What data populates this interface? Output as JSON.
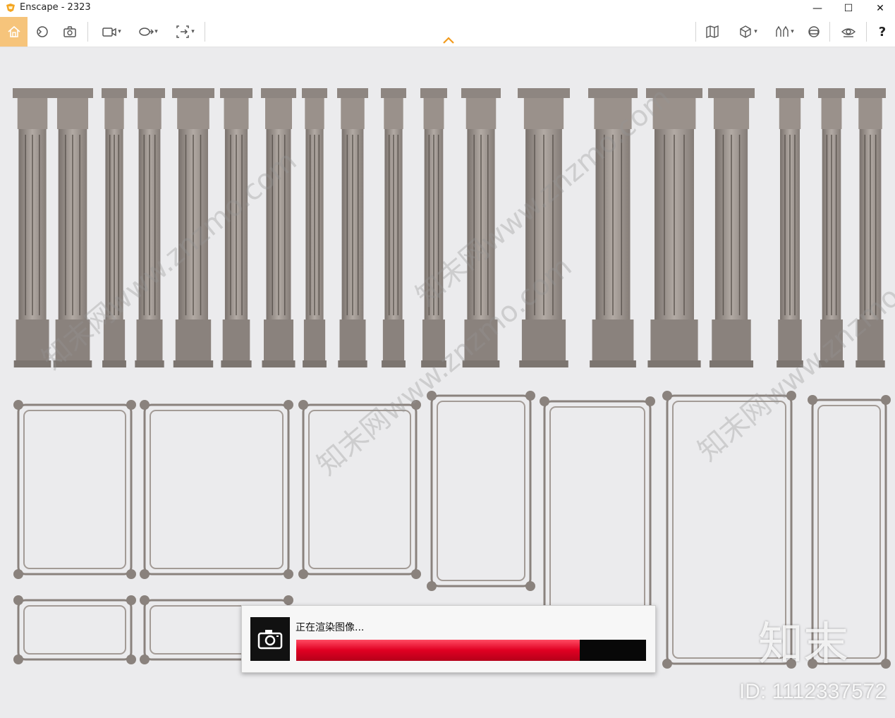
{
  "window": {
    "title": "Enscape - 2323"
  },
  "window_controls": {
    "minimize": "—",
    "maximize": "☐",
    "close": "✕"
  },
  "toolbar": {
    "left_icons": [
      "home-icon",
      "orbit-icon",
      "screenshot-icon",
      "video-camera-icon",
      "batch-render-icon",
      "export-icon"
    ],
    "right_icons": [
      "map-icon",
      "cube-view-icon",
      "assets-icon",
      "vr-headset-icon",
      "visual-settings-icon"
    ],
    "help_label": "?",
    "accent_color": "#f6c47b"
  },
  "overlay": {
    "watermark_logo": "知末",
    "watermark_id": "ID: 1112337572",
    "watermark_url": "知末网www.znzmo.com"
  },
  "render_dialog": {
    "label": "正在渲染图像...",
    "progress": 0.81,
    "bar_color": "#e00022"
  }
}
